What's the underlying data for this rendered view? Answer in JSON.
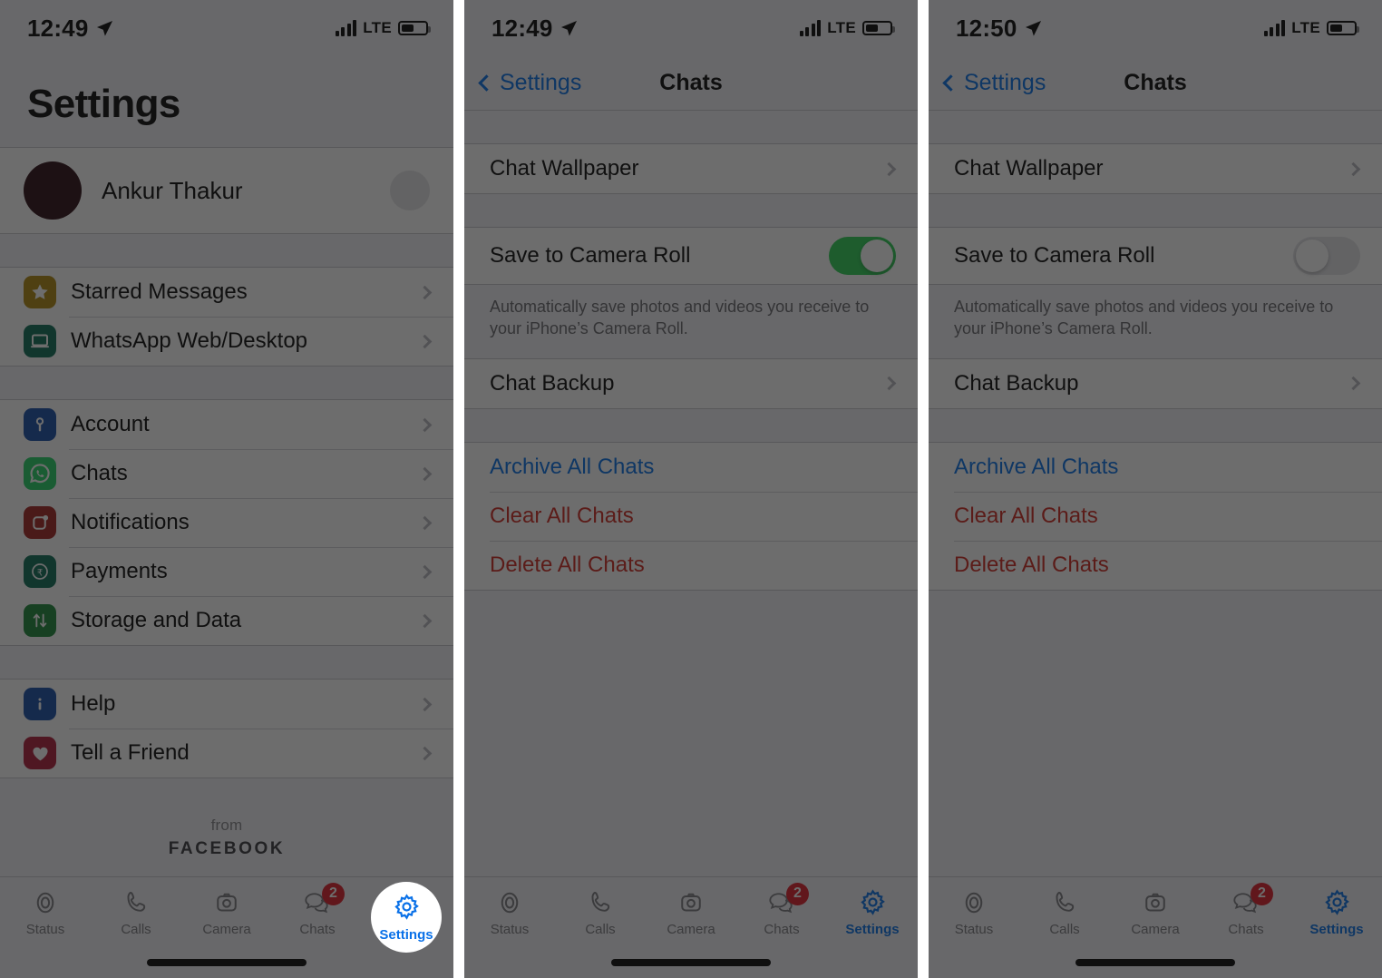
{
  "panels": [
    {
      "id": "settings-list",
      "status": {
        "time": "12:49",
        "network": "LTE",
        "location_icon": "location-arrow-icon"
      },
      "title": "Settings",
      "profile": {
        "name": "Ankur Thakur",
        "avatar": "avatar",
        "qr": "qr-code-icon"
      },
      "groups": [
        {
          "items": [
            {
              "label": "Starred Messages",
              "icon": "star-icon",
              "icon_color": "#b08a12",
              "highlight": false
            },
            {
              "label": "WhatsApp Web/Desktop",
              "icon": "laptop-icon",
              "icon_color": "#0e6e58",
              "highlight": false
            }
          ]
        },
        {
          "items": [
            {
              "label": "Account",
              "icon": "key-icon",
              "icon_color": "#1a4fa8",
              "highlight": false
            },
            {
              "label": "Chats",
              "icon": "whatsapp-icon",
              "icon_color": "#25d366",
              "highlight": true
            },
            {
              "label": "Notifications",
              "icon": "bell-badge-icon",
              "icon_color": "#a32622",
              "highlight": false
            },
            {
              "label": "Payments",
              "icon": "rupee-icon",
              "icon_color": "#0e6e58",
              "highlight": false
            },
            {
              "label": "Storage and Data",
              "icon": "arrows-updown-icon",
              "icon_color": "#1f8a3c",
              "highlight": false
            }
          ]
        },
        {
          "items": [
            {
              "label": "Help",
              "icon": "info-icon",
              "icon_color": "#1a4fa8",
              "highlight": false
            },
            {
              "label": "Tell a Friend",
              "icon": "heart-icon",
              "icon_color": "#b01d3c",
              "highlight": false
            }
          ]
        }
      ],
      "footer": {
        "from": "from",
        "brand": "FACEBOOK"
      }
    },
    {
      "id": "chats-toggle-on",
      "status": {
        "time": "12:49",
        "network": "LTE",
        "location_icon": "location-arrow-icon"
      },
      "nav": {
        "back": "Settings",
        "title": "Chats"
      },
      "wallpaper_row": "Chat Wallpaper",
      "camera_roll": {
        "label": "Save to Camera Roll",
        "state": "on"
      },
      "footnote": "Automatically save photos and videos you receive to your iPhone’s Camera Roll.",
      "backup_row": "Chat Backup",
      "actions": [
        {
          "label": "Archive All Chats",
          "tone": "blue"
        },
        {
          "label": "Clear All Chats",
          "tone": "red"
        },
        {
          "label": "Delete All Chats",
          "tone": "red"
        }
      ]
    },
    {
      "id": "chats-toggle-off",
      "status": {
        "time": "12:50",
        "network": "LTE",
        "location_icon": "location-arrow-icon"
      },
      "nav": {
        "back": "Settings",
        "title": "Chats"
      },
      "wallpaper_row": "Chat Wallpaper",
      "camera_roll": {
        "label": "Save to Camera Roll",
        "state": "off"
      },
      "footnote": "Automatically save photos and videos you receive to your iPhone’s Camera Roll.",
      "backup_row": "Chat Backup",
      "actions": [
        {
          "label": "Archive All Chats",
          "tone": "blue"
        },
        {
          "label": "Clear All Chats",
          "tone": "red"
        },
        {
          "label": "Delete All Chats",
          "tone": "red"
        }
      ]
    }
  ],
  "tabbar": {
    "items": [
      {
        "label": "Status",
        "icon": "status-ring-icon",
        "badge": "",
        "active": false
      },
      {
        "label": "Calls",
        "icon": "phone-icon",
        "badge": "",
        "active": false
      },
      {
        "label": "Camera",
        "icon": "camera-icon",
        "badge": "",
        "active": false
      },
      {
        "label": "Chats",
        "icon": "chat-bubbles-icon",
        "badge": "2",
        "active": false
      },
      {
        "label": "Settings",
        "icon": "gear-icon",
        "badge": "",
        "active": true
      }
    ]
  },
  "colors": {
    "accent_blue": "#0a71e8",
    "destructive_red": "#cf2c24",
    "toggle_on_green": "#30d158",
    "badge_red": "#e01e2b",
    "whatsapp_green": "#25d366"
  }
}
